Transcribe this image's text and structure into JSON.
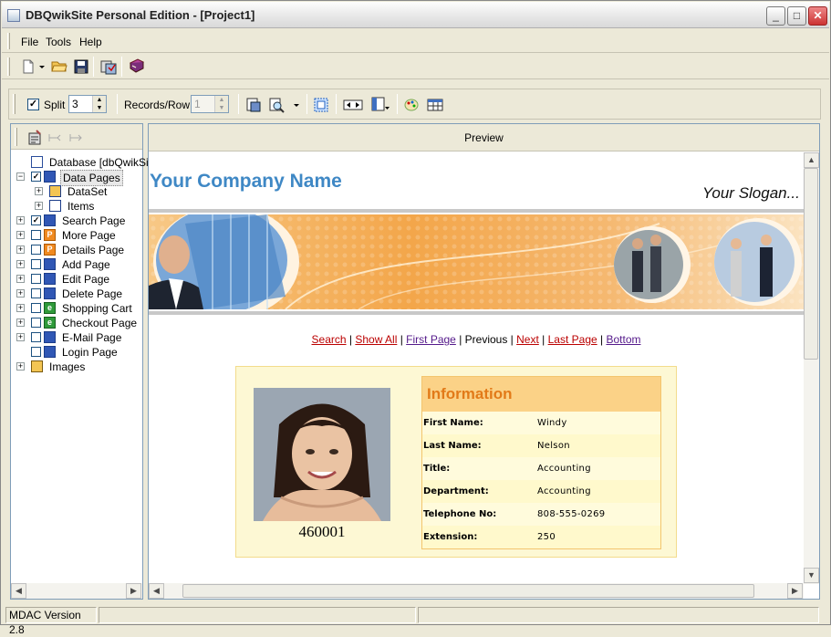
{
  "window": {
    "title": "DBQwikSite Personal Edition - [Project1]",
    "min_label": "_",
    "max_label": "□",
    "close_label": "✕"
  },
  "menu": {
    "file": "File",
    "tools": "Tools",
    "help": "Help"
  },
  "toolbar1": {
    "icons": [
      "new-file-icon",
      "dropdown-arrow-icon",
      "open-folder-icon",
      "save-icon",
      "publish-icon",
      "book-icon"
    ]
  },
  "toolbar2": {
    "split_checked": true,
    "split_label": "Split",
    "split_value": "3",
    "records_label": "Records/Row",
    "records_value": "1",
    "icons": [
      "page-settings-icon",
      "preview-icon",
      "dropdown-arrow-icon",
      "select-area-icon",
      "navigator-icon",
      "columns-icon",
      "palette-icon",
      "table-icon"
    ]
  },
  "tree": {
    "items": [
      {
        "label": "Database [dbQwikSit",
        "checked": null,
        "expander": false,
        "icon": "database-icon",
        "level": 0
      },
      {
        "label": "Data Pages",
        "checked": true,
        "expander": "−",
        "icon": "page-icon",
        "level": 0,
        "selected": true
      },
      {
        "label": "DataSet",
        "checked": null,
        "expander": "+",
        "icon": "dataset-icon",
        "level": 1
      },
      {
        "label": "Items",
        "checked": null,
        "expander": "+",
        "icon": "items-icon",
        "level": 1
      },
      {
        "label": "Search Page",
        "checked": true,
        "expander": "+",
        "icon": "page-icon",
        "level": 0
      },
      {
        "label": "More Page",
        "checked": false,
        "expander": "+",
        "icon": "p-icon",
        "level": 0
      },
      {
        "label": "Details Page",
        "checked": false,
        "expander": "+",
        "icon": "p-icon",
        "level": 0
      },
      {
        "label": "Add Page",
        "checked": false,
        "expander": "+",
        "icon": "page-icon",
        "level": 0
      },
      {
        "label": "Edit Page",
        "checked": false,
        "expander": "+",
        "icon": "page-icon",
        "level": 0
      },
      {
        "label": "Delete Page",
        "checked": false,
        "expander": "+",
        "icon": "page-icon",
        "level": 0
      },
      {
        "label": "Shopping Cart",
        "checked": false,
        "expander": "+",
        "icon": "e-icon",
        "level": 0
      },
      {
        "label": "Checkout Page",
        "checked": false,
        "expander": "+",
        "icon": "e-icon",
        "level": 0
      },
      {
        "label": "E-Mail Page",
        "checked": false,
        "expander": "+",
        "icon": "page-icon",
        "level": 0
      },
      {
        "label": "Login Page",
        "checked": false,
        "expander": false,
        "icon": "page-icon",
        "level": 0
      },
      {
        "label": "Images",
        "checked": null,
        "expander": "+",
        "icon": "images-icon",
        "level": 0
      }
    ]
  },
  "preview": {
    "header": "Preview",
    "company_name": "Your Company Name",
    "slogan": "Your Slogan...",
    "nav": {
      "search": "Search",
      "sep": " | ",
      "show_all": "Show All",
      "first_page": "First Page",
      "previous": "Previous",
      "next": "Next",
      "last_page": "Last Page",
      "bottom": "Bottom"
    },
    "record": {
      "id": "460001",
      "info_title": "Information",
      "fields": [
        {
          "key": "First Name:",
          "value": "Windy"
        },
        {
          "key": "Last Name:",
          "value": "Nelson"
        },
        {
          "key": "Title:",
          "value": "Accounting"
        },
        {
          "key": "Department:",
          "value": "Accounting"
        },
        {
          "key": "Telephone No:",
          "value": "808-555-0269"
        },
        {
          "key": "Extension:",
          "value": "250"
        }
      ]
    }
  },
  "status": {
    "mdac": "MDAC Version 2.8"
  },
  "colors": {
    "company": "#3f88c5",
    "info_title": "#e27a18",
    "link": "#bb0000",
    "banner": "#f3a64a"
  }
}
